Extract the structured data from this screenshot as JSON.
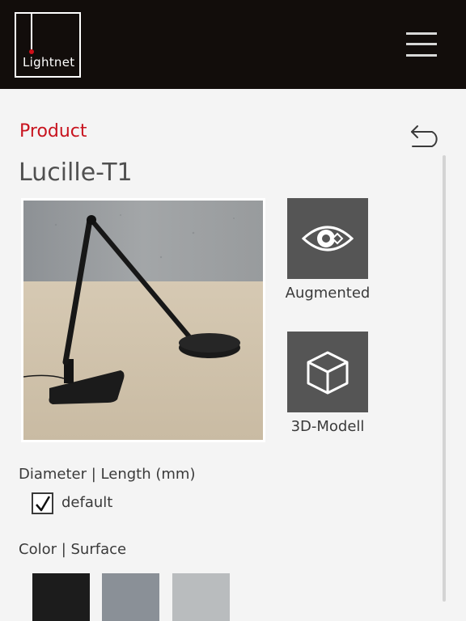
{
  "header": {
    "logo_text": "Lightnet",
    "logo_accent_color": "#d0101a",
    "menu_icon": "hamburger-menu-icon"
  },
  "main": {
    "section_title": "Product",
    "back_icon": "undo-arrow-icon",
    "product_name": "Lucille-T1",
    "actions": [
      {
        "label": "Augmented",
        "icon": "eye-ar-icon"
      },
      {
        "label": "3D-Modell",
        "icon": "cube-icon"
      }
    ],
    "dimension": {
      "heading": "Diameter | Length (mm)",
      "options": [
        {
          "label": "default",
          "checked": true
        }
      ]
    },
    "color": {
      "heading": "Color | Surface",
      "swatches": [
        "#1c1c1c",
        "#8a9097",
        "#b9bcbe"
      ]
    }
  },
  "colors": {
    "accent": "#c8141f",
    "topbar": "#120d0b",
    "tile": "#555555"
  }
}
